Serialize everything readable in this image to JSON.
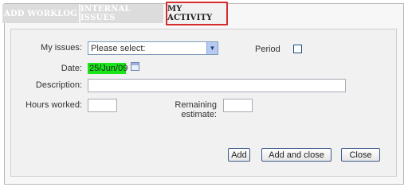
{
  "tabs": [
    {
      "label": "ADD WORKLOG"
    },
    {
      "label": "INTERNAL ISSUES"
    },
    {
      "label": "MY ACTIVITY"
    }
  ],
  "form": {
    "my_issues_label": "My issues:",
    "my_issues_selected": "Please select:",
    "period_label": "Period",
    "date_label": "Date:",
    "date_value": "25/Jun/09",
    "description_label": "Description:",
    "description_value": "",
    "hours_label": "Hours worked:",
    "hours_value": "",
    "remaining_label": "Remaining estimate:",
    "remaining_value": ""
  },
  "buttons": {
    "add": "Add",
    "add_close": "Add and close",
    "close": "Close"
  },
  "colors": {
    "active_tab_highlight": "#d72c2c",
    "date_highlight": "#19e519"
  }
}
